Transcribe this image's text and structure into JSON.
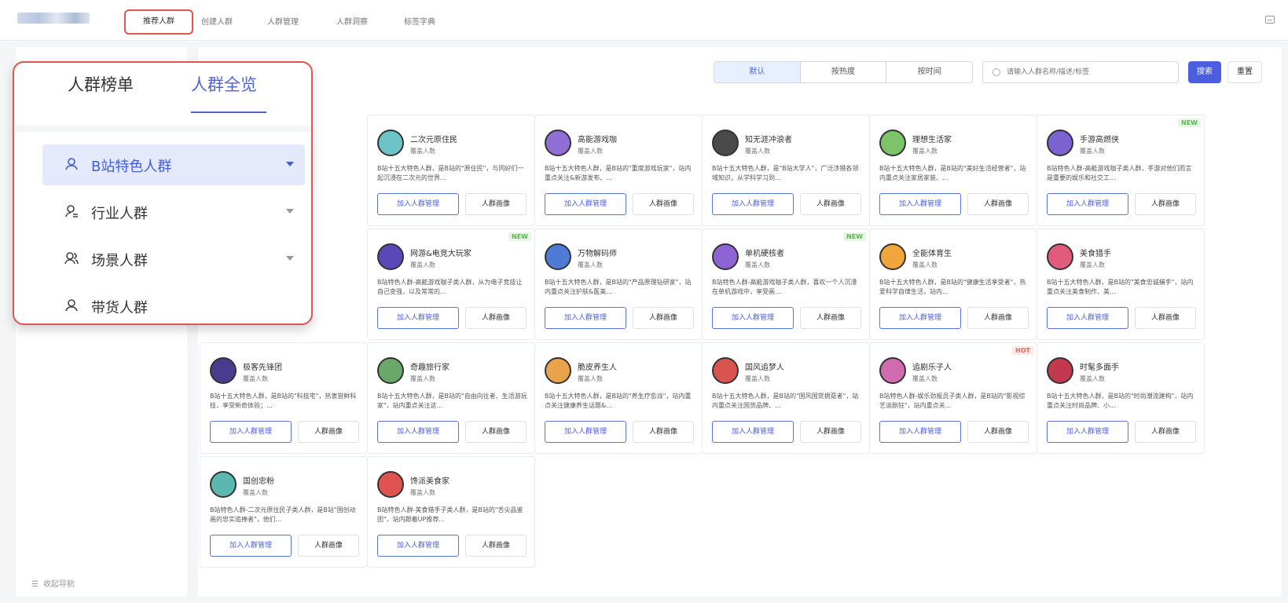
{
  "topbar": {
    "nav_active": "推荐人群",
    "nav": [
      "创建人群",
      "人群管理",
      "人群洞察",
      "标签字典"
    ]
  },
  "sidebar": {
    "collapse_label": "收起导航"
  },
  "toolbar": {
    "sort_options": [
      "默认",
      "按热度",
      "按时间"
    ],
    "search_placeholder": "请输入人群名称/描述/标签",
    "search_label": "搜索",
    "reset_label": "重置"
  },
  "card_buttons": {
    "add": "加入人群管理",
    "portrait": "人群画像"
  },
  "cards": [
    {
      "title": "二次元原住民",
      "meta": "覆盖人数",
      "desc": "B站十五大特色人群，是B站的\"原住民\"，与同好们一起沉浸在二次元的世界...",
      "badge": "",
      "color": "#6cc4c9"
    },
    {
      "title": "高能游戏咖",
      "meta": "覆盖人数",
      "desc": "B站十五大特色人群，是B站的\"重度游戏玩家\"，站内重点关注&新游发布、...",
      "badge": "",
      "color": "#8f6fd6"
    },
    {
      "title": "知无涯冲浪者",
      "meta": "覆盖人数",
      "desc": "B站十五大特色人群，是\"B站大学人\"，广泛涉猎各领域知识，从学科学习到...",
      "badge": "",
      "color": "#4a4a4a"
    },
    {
      "title": "理想生活家",
      "meta": "覆盖人数",
      "desc": "B站十五大特色人群，是B站的\"美好生活经营者\"，站内重点关注家居家装、...",
      "badge": "",
      "color": "#7cc36a"
    },
    {
      "title": "手游高燃侠",
      "meta": "覆盖人数",
      "desc": "B站特色人群-高能游戏咖子类人群，手游对他们而言是重要的娱乐和社交工...",
      "badge": "NEW",
      "color": "#7a62d1"
    },
    {
      "title": "网游&电竞大玩家",
      "meta": "覆盖人数",
      "desc": "B站特色人群-高能游戏咖子类人群，从为电子竞技让自己变强，以及常常的...",
      "badge": "NEW",
      "color": "#5a47b8"
    },
    {
      "title": "万物解码师",
      "meta": "覆盖人数",
      "desc": "B站十五大特色人群，是B站的\"产品原理钻研家\"，站内重点关注护肤&医美...",
      "badge": "",
      "color": "#4f7bd6"
    },
    {
      "title": "单机硬核者",
      "meta": "覆盖人数",
      "desc": "B站特色人群-高能游戏咖子类人群，喜欢一个人沉浸在单机游戏中，享受画...",
      "badge": "NEW",
      "color": "#8e63d3"
    },
    {
      "title": "全能体育生",
      "meta": "覆盖人数",
      "desc": "B站十五大特色人群，是B站的\"健康生活享受者\"，热爱科学自律生活，站内...",
      "badge": "",
      "color": "#f0a63b"
    },
    {
      "title": "美食猎手",
      "meta": "覆盖人数",
      "desc": "B站十五大特色人群，是B站的\"美食忠诚捕手\"，站内重点关注美食制作、美...",
      "badge": "",
      "color": "#e25b7a"
    },
    {
      "title": "极客先锋团",
      "meta": "覆盖人数",
      "desc": "B站十五大特色人群，是B站的\"科技宅\"，热衷尝鲜科技，享受新奇体验；...",
      "badge": "",
      "color": "#4b3b8f"
    },
    {
      "title": "奇趣旅行家",
      "meta": "覆盖人数",
      "desc": "B站十五大特色人群，是B站的\"自由向往者、生活游玩家\"，站内重点关注这...",
      "badge": "",
      "color": "#6aa86a"
    },
    {
      "title": "脆皮养生人",
      "meta": "覆盖人数",
      "desc": "B站十五大特色人群，是B站的\"养生疗愈派\"，站内重点关注健康养生话题&...",
      "badge": "",
      "color": "#e9a34a"
    },
    {
      "title": "国风追梦人",
      "meta": "覆盖人数",
      "desc": "B站十五大特色人群，是B站的\"国风国货拥趸者\"，站内重点关注国货品牌、...",
      "badge": "",
      "color": "#d9534f"
    },
    {
      "title": "追剧乐子人",
      "meta": "覆盖人数",
      "desc": "B站特色人群-娱乐劲报员子类人群，是B站的\"影视综艺谈剧狂\"，站内重点关...",
      "badge": "HOT",
      "color": "#d16bb0"
    },
    {
      "title": "时髦多面手",
      "meta": "覆盖人数",
      "desc": "B站十五大特色人群，是B站的\"时尚潮流建构\"，站内重点关注时尚品牌、小...",
      "badge": "",
      "color": "#c2394f"
    },
    {
      "title": "国创忠粉",
      "meta": "覆盖人数",
      "desc": "B站特色人群-二次元原住民子类人群，是B站\"国创动画的忠实追捧者\"，他们...",
      "badge": "",
      "color": "#5bb8b0"
    },
    {
      "title": "馋派美食家",
      "meta": "覆盖人数",
      "desc": "B站特色人群-美食猎手子类人群，是B站的\"舌尖品鉴团\"，站内跟着UP推荐...",
      "badge": "",
      "color": "#e0544f"
    }
  ],
  "overlay": {
    "tabs": [
      "人群榜单",
      "人群全览"
    ],
    "items": [
      "B站特色人群",
      "行业人群",
      "场景人群",
      "带货人群"
    ]
  }
}
